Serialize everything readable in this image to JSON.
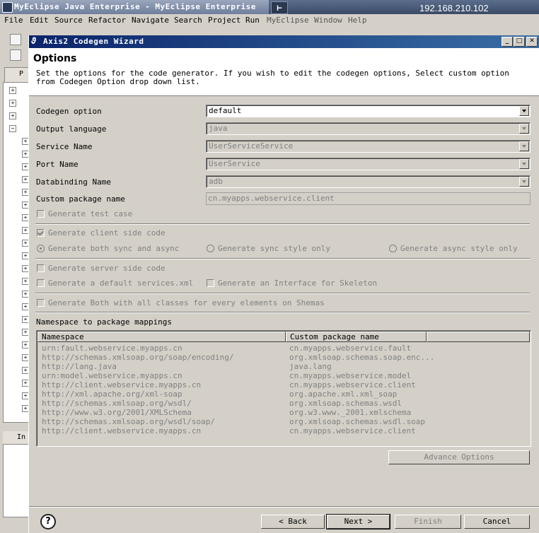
{
  "bg_window": {
    "title": "MyEclipse Java Enterprise - MyEclipse Enterprise",
    "ip": "192.168.210.102",
    "menu": [
      "File",
      "Edit",
      "Source",
      "Refactor",
      "Navigate",
      "Search",
      "Project",
      "Run",
      "MyEclipse",
      "Window",
      "Help"
    ],
    "pkg_tab": "P",
    "info_tab": "In"
  },
  "dialog": {
    "title": "Axis2 Codegen Wizard",
    "page_title": "Options",
    "description_1": "Set the options for the code generator. If you wish to edit the codegen options, Select custom option",
    "description_2": "from Codegen Option drop down list.",
    "fields": {
      "codegen_option": {
        "label": "Codegen option",
        "value": "default"
      },
      "output_language": {
        "label": "Output language",
        "value": "java"
      },
      "service_name": {
        "label": "Service Name",
        "value": "UserServiceService"
      },
      "port_name": {
        "label": "Port Name",
        "value": "UserService"
      },
      "databinding_name": {
        "label": "Databinding Name",
        "value": "adb"
      },
      "custom_package_name": {
        "label": "Custom package name",
        "value": "cn.myapps.webservice.client"
      }
    },
    "options": {
      "generate_test_case": "Generate test case",
      "generate_client_side": "Generate client side code",
      "sync_async": "Generate both sync and async",
      "sync_only": "Generate sync style only",
      "async_only": "Generate async style only",
      "generate_server_side": "Generate server side code",
      "default_services_xml": "Generate a default services.xml",
      "interface_skeleton": "Generate an Interface for Skeleton",
      "generate_all_classes": "Generate Both with all classes for every elements on Shemas"
    },
    "mapping": {
      "label": "Namespace to package mappings",
      "col_namespace": "Namespace",
      "col_package": "Custom package name",
      "rows": [
        {
          "ns": "urn:fault.webservice.myapps.cn",
          "pkg": "cn.myapps.webservice.fault"
        },
        {
          "ns": "http://schemas.xmlsoap.org/soap/encoding/",
          "pkg": "org.xmlsoap.schemas.soap.enc..."
        },
        {
          "ns": "http://lang.java",
          "pkg": "java.lang"
        },
        {
          "ns": "urn:model.webservice.myapps.cn",
          "pkg": "cn.myapps.webservice.model"
        },
        {
          "ns": "http://client.webservice.myapps.cn",
          "pkg": "cn.myapps.webservice.client"
        },
        {
          "ns": "http://xml.apache.org/xml-soap",
          "pkg": "org.apache.xml.xml_soap"
        },
        {
          "ns": "http://schemas.xmlsoap.org/wsdl/",
          "pkg": "org.xmlsoap.schemas.wsdl"
        },
        {
          "ns": "http://www.w3.org/2001/XMLSchema",
          "pkg": "org.w3.www._2001.xmlschema"
        },
        {
          "ns": "http://schemas.xmlsoap.org/wsdl/soap/",
          "pkg": "org.xmlsoap.schemas.wsdl.soap"
        },
        {
          "ns": "http://client.webservice.myapps.cn",
          "pkg": "cn.myapps.webservice.client"
        }
      ]
    },
    "buttons": {
      "advance_options": "Advance Options",
      "back": "< Back",
      "next": "Next >",
      "finish": "Finish",
      "cancel": "Cancel",
      "help": "?"
    }
  }
}
